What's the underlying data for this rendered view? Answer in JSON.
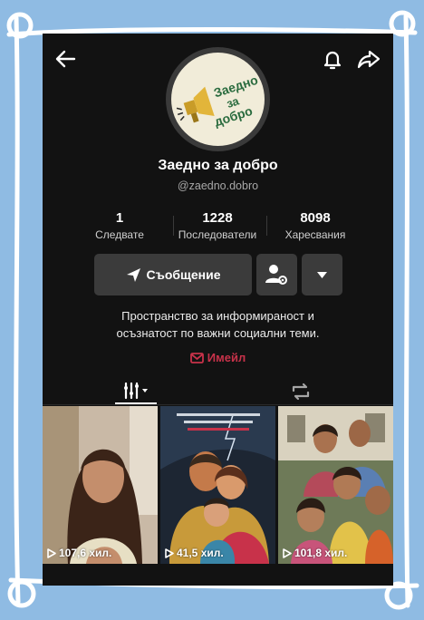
{
  "profile": {
    "name": "Заедно за добро",
    "handle": "@zaedno.dobro",
    "logo_text": [
      "Заедно",
      "за",
      "добро"
    ]
  },
  "stats": [
    {
      "value": "1",
      "label": "Следвате"
    },
    {
      "value": "1228",
      "label": "Последователи"
    },
    {
      "value": "8098",
      "label": "Харесвания"
    }
  ],
  "actions": {
    "message_label": "Съобщение"
  },
  "bio": {
    "line1": "Пространство за информираност и",
    "line2": "осъзнатост по важни социални теми."
  },
  "email_label": "Имейл",
  "videos": [
    {
      "views": "107,6 хил.",
      "icon": "play-icon"
    },
    {
      "views": "41,5 хил.",
      "icon": "play-icon"
    },
    {
      "views": "101,8 хил.",
      "icon": "play-icon"
    }
  ],
  "colors": {
    "background": "#8fbbe3",
    "screen": "#121212",
    "button": "#3b3b3b",
    "email_accent": "#c8324a"
  }
}
